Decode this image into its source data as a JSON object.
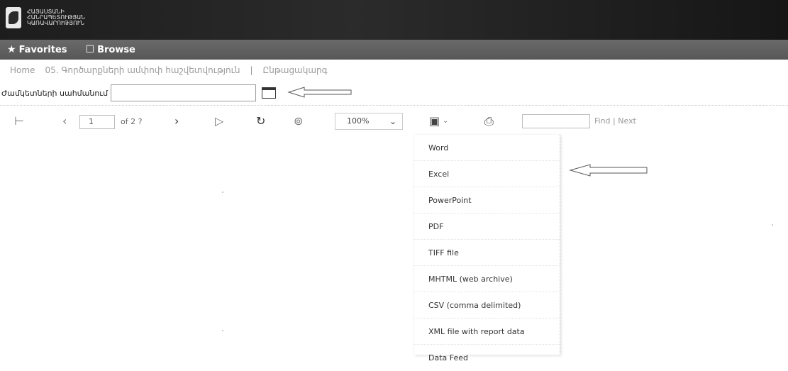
{
  "header": {
    "logo_text": "ՀԱՅԱՍՏԱՆԻ ՀԱՆՐԱՊԵՏՈՒԹՅԱՆ ԿԱՌԱՎԱՐՈՒԹՅՈՒՆ"
  },
  "nav": {
    "favorites": "Favorites",
    "browse": "Browse"
  },
  "breadcrumb": {
    "home": "Home",
    "report": "05. Գործարքների ամփոփ հաշվետվություն",
    "sep": "|",
    "last": "Ընթացակարգ"
  },
  "parameter": {
    "label": "Ժամկետների սահմանում",
    "value": ""
  },
  "toolbar": {
    "page_value": "1",
    "page_of": "of 2 ?",
    "zoom": "100%",
    "find": "Find",
    "next": "Next",
    "find_sep": "|"
  },
  "export_menu": {
    "items": [
      "Word",
      "Excel",
      "PowerPoint",
      "PDF",
      "TIFF file",
      "MHTML (web archive)",
      "CSV (comma delimited)",
      "XML file with report data",
      "Data Feed"
    ]
  }
}
